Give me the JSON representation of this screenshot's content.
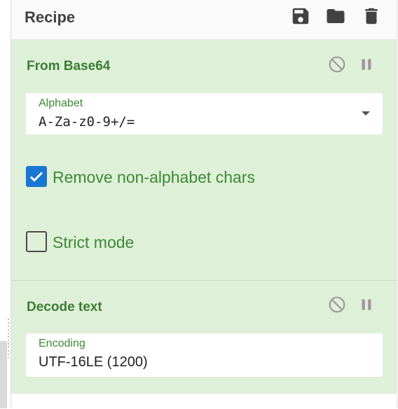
{
  "recipe": {
    "title": "Recipe",
    "icons": [
      "save-icon",
      "folder-icon",
      "trash-icon"
    ]
  },
  "operations": [
    {
      "title": "From Base64",
      "alphabet": {
        "label": "Alphabet",
        "value": "A-Za-z0-9+/="
      },
      "remove_non_alphabet": {
        "label": "Remove non-alphabet chars",
        "checked": true
      },
      "strict_mode": {
        "label": "Strict mode",
        "checked": false
      }
    },
    {
      "title": "Decode text",
      "encoding": {
        "label": "Encoding",
        "value": "UTF-16LE (1200)"
      }
    }
  ],
  "colors": {
    "op_background": "#dff0d8",
    "op_text": "#3c7d34",
    "checkbox_checked": "#1976d2"
  }
}
